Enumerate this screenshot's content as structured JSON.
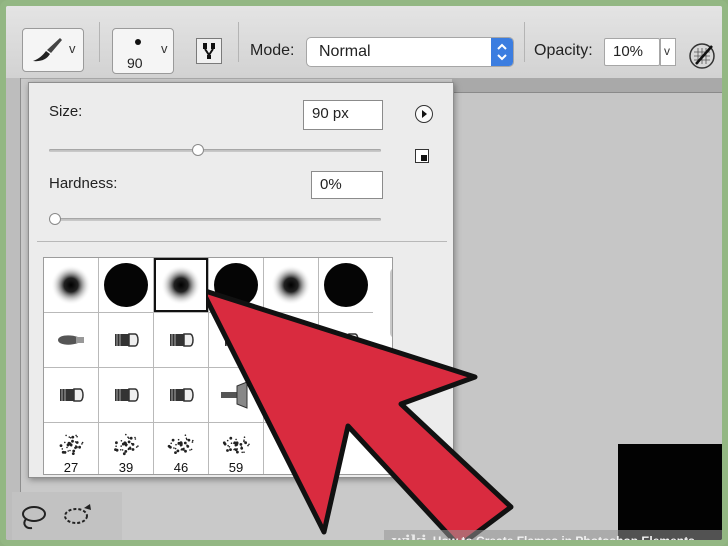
{
  "toolbar": {
    "brush_size_value": "90",
    "mode_label": "Mode:",
    "mode_value": "Normal",
    "opacity_label": "Opacity:",
    "opacity_value": "10%",
    "dropdown_glyph": "v"
  },
  "brush_popup": {
    "size_label": "Size:",
    "size_value": "90 px",
    "size_slider_fraction": 0.45,
    "hardness_label": "Hardness:",
    "hardness_value": "0%",
    "hardness_slider_fraction": 0.0,
    "presets": [
      {
        "kind": "soft-round",
        "label": ""
      },
      {
        "kind": "hard-round",
        "label": ""
      },
      {
        "kind": "soft-round",
        "label": "",
        "selected": true
      },
      {
        "kind": "hard-round",
        "label": ""
      },
      {
        "kind": "soft-round",
        "label": ""
      },
      {
        "kind": "hard-round",
        "label": ""
      },
      {
        "kind": "chisel",
        "label": ""
      },
      {
        "kind": "flat",
        "label": ""
      },
      {
        "kind": "flat",
        "label": ""
      },
      {
        "kind": "flat",
        "label": ""
      },
      {
        "kind": "flat",
        "label": ""
      },
      {
        "kind": "flat",
        "label": ""
      },
      {
        "kind": "flat",
        "label": ""
      },
      {
        "kind": "flat",
        "label": ""
      },
      {
        "kind": "flat",
        "label": ""
      },
      {
        "kind": "fan",
        "label": ""
      },
      {
        "kind": "blank",
        "label": ""
      },
      {
        "kind": "blank",
        "label": ""
      },
      {
        "kind": "spatter",
        "label": "27"
      },
      {
        "kind": "spatter",
        "label": "39"
      },
      {
        "kind": "spatter",
        "label": "46"
      },
      {
        "kind": "spatter",
        "label": "59"
      },
      {
        "kind": "blank",
        "label": ""
      },
      {
        "kind": "blank",
        "label": ""
      }
    ]
  },
  "watermark": {
    "brand": "wiki",
    "text": "How to Create Flames in Photoshop Elements"
  },
  "colors": {
    "arrow_fill": "#d92b3f",
    "arrow_stroke": "#111111",
    "frame_border": "#93b783"
  },
  "icons": [
    "brush-icon",
    "brush-size-dot-icon",
    "brush-settings-icon",
    "chevron-updown-icon",
    "tablet-pressure-icon",
    "play-circle-icon",
    "small-menu-icon",
    "lasso-icon"
  ]
}
